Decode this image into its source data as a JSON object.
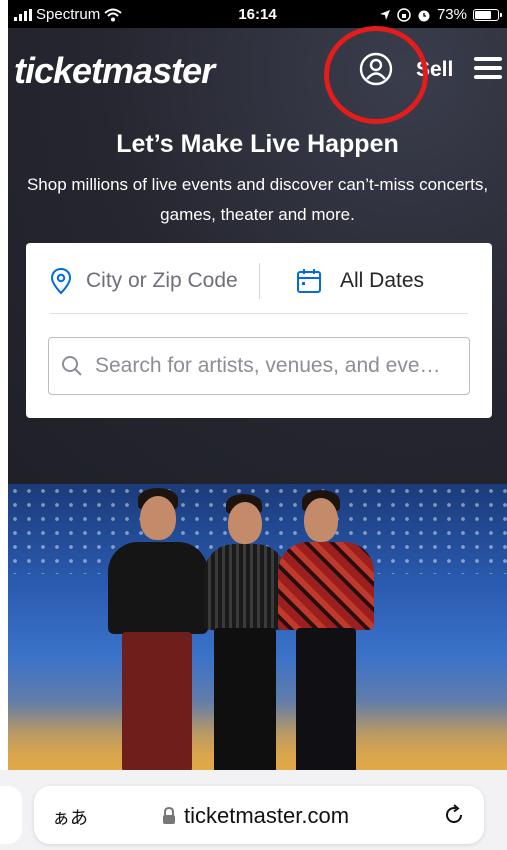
{
  "status_bar": {
    "carrier": "Spectrum",
    "time": "16:14",
    "battery_text": "73%",
    "battery_level": 0.73,
    "icons": [
      "signal-icon",
      "wifi-icon",
      "location-arrow-icon",
      "orientation-lock-icon",
      "alarm-icon",
      "battery-icon"
    ]
  },
  "nav": {
    "logo": "ticketmaster",
    "sell_label": "Sell",
    "icons": [
      "account-icon",
      "hamburger-menu-icon"
    ]
  },
  "hero": {
    "headline": "Let’s Make Live Happen",
    "subheadline": "Shop millions of live events and discover can’t-miss concerts, games, theater and more."
  },
  "search": {
    "location_placeholder": "City or Zip Code",
    "date_value": "All Dates",
    "query_placeholder": "Search for artists, venues, and eve…"
  },
  "browser": {
    "aa_label": "ぁあ",
    "url": "ticketmaster.com"
  },
  "colors": {
    "hero_bg": "#25262f",
    "brand_blue": "#026cdf",
    "annotation_red": "#e41c1c"
  }
}
